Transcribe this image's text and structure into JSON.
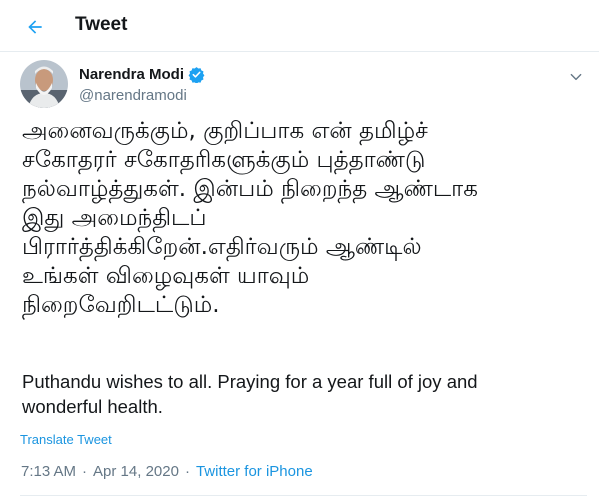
{
  "header": {
    "title": "Tweet",
    "back_icon": "arrow-left-icon"
  },
  "author": {
    "name": "Narendra Modi",
    "handle": "@narendramodi",
    "verified_icon": "verified-badge-icon",
    "avatar": "profile-photo"
  },
  "tweet": {
    "tamil_lines": [
      "அனைவருக்கும், குறிப்பாக என் தமிழ்ச்",
      "சகோதரர் சகோதரிகளுக்கும் புத்தாண்டு",
      "நல்வாழ்த்துகள். இன்பம் நிறைந்த ஆண்டாக",
      "இது அமைந்திடப்",
      "பிரார்த்திக்கிறேன்.எதிர்வரும் ஆண்டில்",
      "உங்கள் விழைவுகள் யாவும்",
      "நிறைவேறிடட்டும்."
    ],
    "english_lines": [
      "Puthandu wishes to all. Praying for a year full of joy and",
      "wonderful health."
    ],
    "translate_label": "Translate Tweet",
    "time": "7:13 AM",
    "separator": "·",
    "date": "Apr 14, 2020",
    "source": "Twitter for iPhone"
  },
  "colors": {
    "accent": "#1da1f2",
    "link": "#1b95e0",
    "text": "#14171a",
    "secondary": "#657786",
    "border": "#e6ecf0"
  }
}
